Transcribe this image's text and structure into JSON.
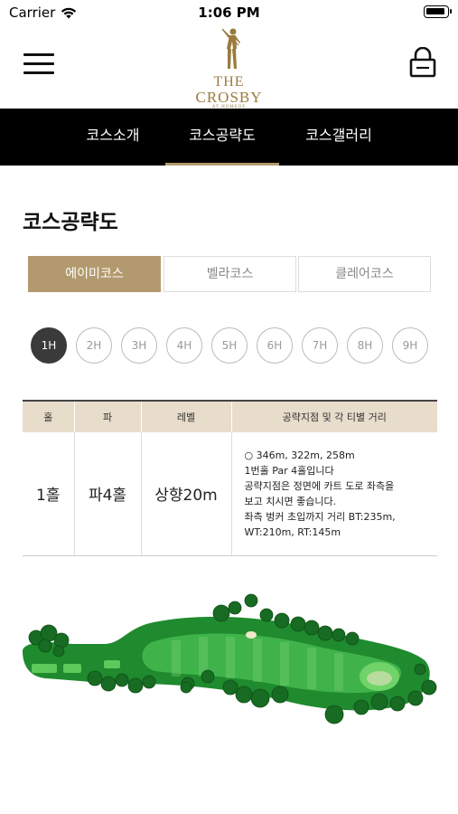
{
  "status_bar": {
    "carrier": "Carrier",
    "time": "1:06 PM"
  },
  "header": {
    "logo": {
      "line1": "THE",
      "line2": "CROSBY",
      "line3": "AT HOMEOF"
    },
    "menu_icon": "hamburger-menu-icon",
    "lock_icon": "lock-icon"
  },
  "nav_tabs": [
    {
      "label": "코스소개",
      "active": false
    },
    {
      "label": "코스공략도",
      "active": true
    },
    {
      "label": "코스갤러리",
      "active": false
    }
  ],
  "page_title": "코스공략도",
  "courses": [
    {
      "label": "에이미코스",
      "active": true
    },
    {
      "label": "벨라코스",
      "active": false
    },
    {
      "label": "클레어코스",
      "active": false
    }
  ],
  "holes": [
    "1H",
    "2H",
    "3H",
    "4H",
    "5H",
    "6H",
    "7H",
    "8H",
    "9H"
  ],
  "active_hole": "1H",
  "table": {
    "headers": [
      "홀",
      "파",
      "레벨",
      "공략지점 및 각 티별 거리"
    ],
    "row": {
      "hole": "1홀",
      "par": "파4홀",
      "level": "상향20m",
      "description": [
        "○ 346m, 322m, 258m",
        "1번홀 Par 4홀입니다",
        "공략지점은 정면에 카트 도로 좌측을",
        "보고 치시면 좋습니다.",
        "좌측 벙커 초입까지 거리 BT:235m,",
        "WT:210m, RT:145m"
      ]
    }
  },
  "colors": {
    "accent": "#b39a6e",
    "nav_bg": "#000000",
    "table_header_bg": "#e8dccb",
    "fairway": "#3fb34a",
    "rough": "#1f8a2e"
  }
}
